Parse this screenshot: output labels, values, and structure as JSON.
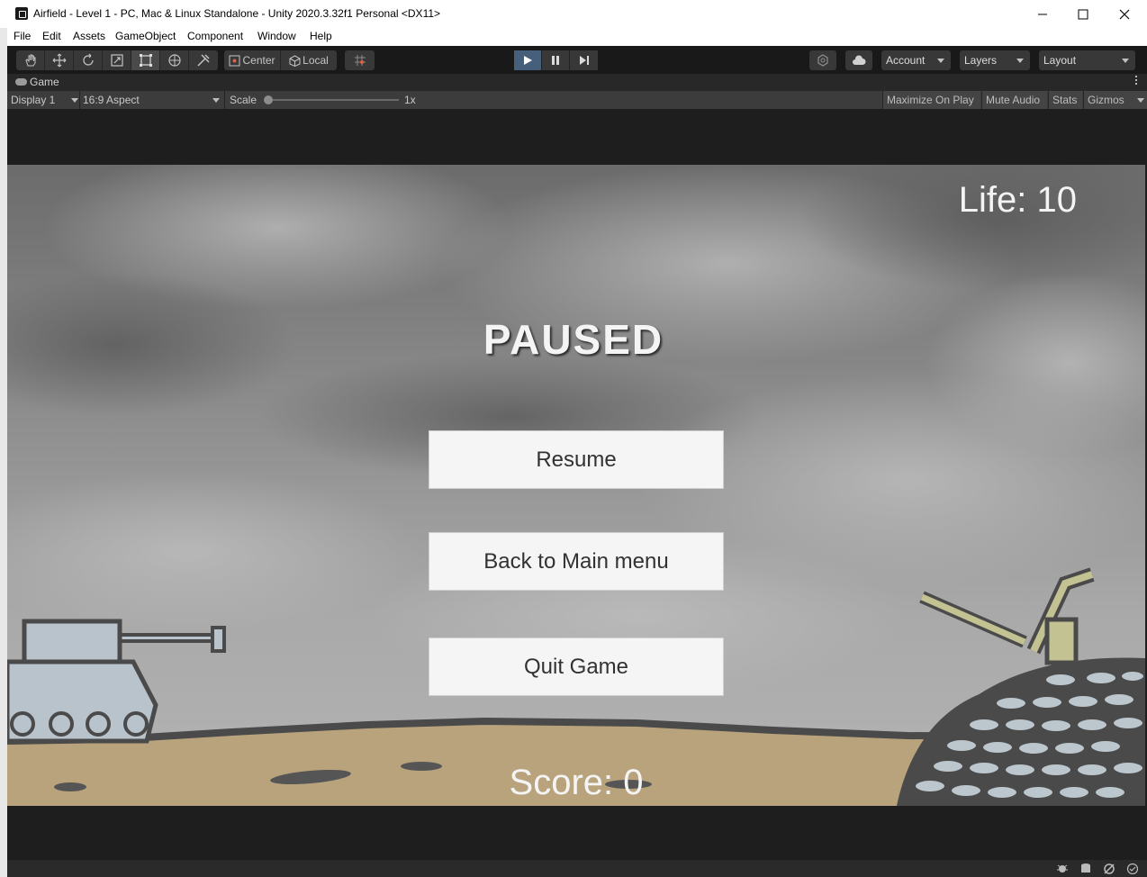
{
  "window": {
    "title": "Airfield - Level 1 - PC, Mac & Linux Standalone - Unity 2020.3.32f1 Personal <DX11>"
  },
  "menu": [
    "File",
    "Edit",
    "Assets",
    "GameObject",
    "Component",
    "Window",
    "Help"
  ],
  "toolbar": {
    "pivot_label": "Center",
    "space_label": "Local",
    "account_label": "Account",
    "layers_label": "Layers",
    "layout_label": "Layout"
  },
  "game_tab": {
    "label": "Game"
  },
  "game_bar": {
    "display": "Display 1",
    "aspect": "16:9 Aspect",
    "scale_label": "Scale",
    "scale_value": "1x",
    "maximize": "Maximize On Play",
    "mute": "Mute Audio",
    "stats": "Stats",
    "gizmos": "Gizmos"
  },
  "game": {
    "life_text": "Life: 10",
    "paused_title": "PAUSED",
    "buttons": {
      "resume": "Resume",
      "main_menu": "Back to Main menu",
      "quit": "Quit Game"
    },
    "score_text": "Score: 0"
  },
  "colors": {
    "editor_dark": "#191919",
    "play_active": "#46607c",
    "sand": "#b9a37c",
    "tank_body": "#b9c3cb",
    "turret_green": "#c2c293"
  }
}
